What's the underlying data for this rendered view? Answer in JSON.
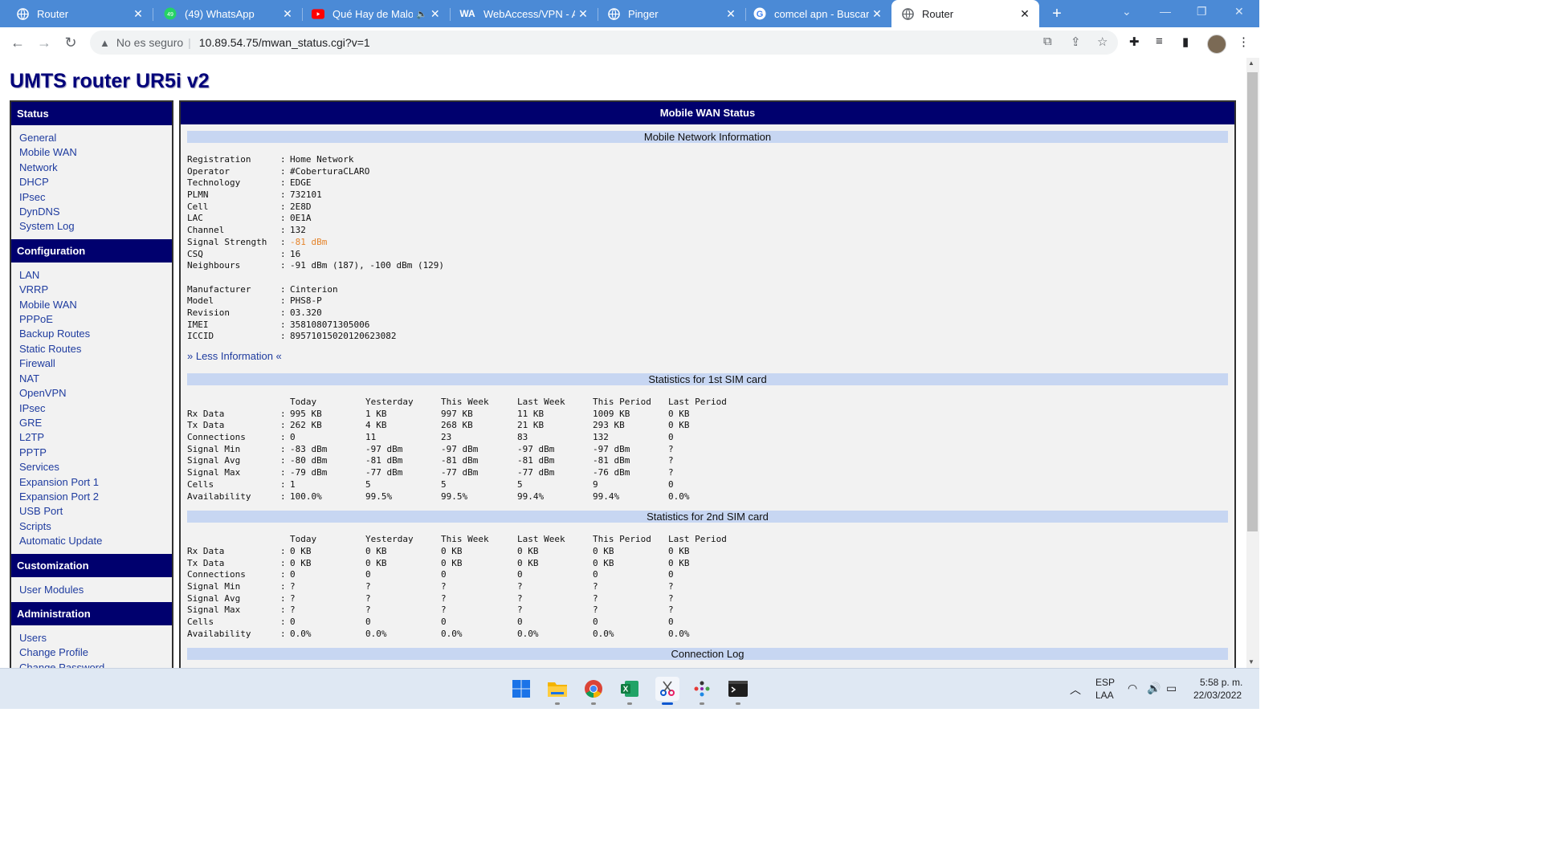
{
  "browser": {
    "tabs": [
      {
        "label": "Router",
        "icon": "globe-icon"
      },
      {
        "label": "(49) WhatsApp",
        "icon": "whatsapp-icon"
      },
      {
        "label": "Qué Hay de Malo",
        "icon": "youtube-icon"
      },
      {
        "label": "WebAccess/VPN - Ad",
        "icon": "webaccess-icon"
      },
      {
        "label": "Pinger",
        "icon": "globe-icon"
      },
      {
        "label": "comcel apn - Buscar",
        "icon": "google-icon"
      },
      {
        "label": "Router",
        "icon": "globe-icon"
      }
    ],
    "active_tab": 6,
    "security_text": "No es seguro",
    "url": "10.89.54.75/mwan_status.cgi?v=1",
    "badge_whatsapp": "49"
  },
  "page": {
    "title": "UMTS router UR5i v2",
    "sidebar": {
      "sections": [
        {
          "heading": "Status",
          "items": [
            "General",
            "Mobile WAN",
            "Network",
            "DHCP",
            "IPsec",
            "DynDNS",
            "System Log"
          ]
        },
        {
          "heading": "Configuration",
          "items": [
            "LAN",
            "VRRP",
            "Mobile WAN",
            "PPPoE",
            "Backup Routes",
            "Static Routes",
            "Firewall",
            "NAT",
            "OpenVPN",
            "IPsec",
            "GRE",
            "L2TP",
            "PPTP",
            "Services",
            "Expansion Port 1",
            "Expansion Port 2",
            "USB Port",
            "Scripts",
            "Automatic Update"
          ]
        },
        {
          "heading": "Customization",
          "items": [
            "User Modules"
          ]
        },
        {
          "heading": "Administration",
          "items": [
            "Users",
            "Change Profile",
            "Change Password"
          ]
        }
      ]
    },
    "main": {
      "heading": "Mobile WAN Status",
      "network_info": {
        "title": "Mobile Network Information",
        "rows": [
          {
            "key": "Registration",
            "value": "Home Network"
          },
          {
            "key": "Operator",
            "value": "#CoberturaCLARO"
          },
          {
            "key": "Technology",
            "value": "EDGE"
          },
          {
            "key": "PLMN",
            "value": "732101"
          },
          {
            "key": "Cell",
            "value": "2E8D"
          },
          {
            "key": "LAC",
            "value": "0E1A"
          },
          {
            "key": "Channel",
            "value": "132"
          },
          {
            "key": "Signal Strength",
            "value": "-81 dBm"
          },
          {
            "key": "CSQ",
            "value": "16"
          },
          {
            "key": "Neighbours",
            "value": "-91 dBm (187), -100 dBm (129)"
          }
        ],
        "device_rows": [
          {
            "key": "Manufacturer",
            "value": "Cinterion"
          },
          {
            "key": "Model",
            "value": "PHS8-P"
          },
          {
            "key": "Revision",
            "value": "03.320"
          },
          {
            "key": "IMEI",
            "value": "358108071305006"
          },
          {
            "key": "ICCID",
            "value": "89571015020120623082"
          }
        ],
        "signal_color": "#e5842b",
        "less_link": "» Less Information «"
      },
      "stats_columns": [
        "Today",
        "Yesterday",
        "This Week",
        "Last Week",
        "This Period",
        "Last Period"
      ],
      "sim1": {
        "title": "Statistics for 1st SIM card",
        "rows": [
          {
            "label": "Rx Data",
            "values": [
              "995 KB",
              "1 KB",
              "997 KB",
              "11 KB",
              "1009 KB",
              "0 KB"
            ]
          },
          {
            "label": "Tx Data",
            "values": [
              "262 KB",
              "4 KB",
              "268 KB",
              "21 KB",
              "293 KB",
              "0 KB"
            ]
          },
          {
            "label": "Connections",
            "values": [
              "0",
              "11",
              "23",
              "83",
              "132",
              "0"
            ]
          },
          {
            "label": "Signal Min",
            "values": [
              "-83 dBm",
              "-97 dBm",
              "-97 dBm",
              "-97 dBm",
              "-97 dBm",
              "?"
            ]
          },
          {
            "label": "Signal Avg",
            "values": [
              "-80 dBm",
              "-81 dBm",
              "-81 dBm",
              "-81 dBm",
              "-81 dBm",
              "?"
            ]
          },
          {
            "label": "Signal Max",
            "values": [
              "-79 dBm",
              "-77 dBm",
              "-77 dBm",
              "-77 dBm",
              "-76 dBm",
              "?"
            ]
          },
          {
            "label": "Cells",
            "values": [
              "1",
              "5",
              "5",
              "5",
              "9",
              "0"
            ]
          },
          {
            "label": "Availability",
            "values": [
              "100.0%",
              "99.5%",
              "99.5%",
              "99.4%",
              "99.4%",
              "0.0%"
            ]
          }
        ]
      },
      "sim2": {
        "title": "Statistics for 2nd SIM card",
        "rows": [
          {
            "label": "Rx Data",
            "values": [
              "0 KB",
              "0 KB",
              "0 KB",
              "0 KB",
              "0 KB",
              "0 KB"
            ]
          },
          {
            "label": "Tx Data",
            "values": [
              "0 KB",
              "0 KB",
              "0 KB",
              "0 KB",
              "0 KB",
              "0 KB"
            ]
          },
          {
            "label": "Connections",
            "values": [
              "0",
              "0",
              "0",
              "0",
              "0",
              "0"
            ]
          },
          {
            "label": "Signal Min",
            "values": [
              "?",
              "?",
              "?",
              "?",
              "?",
              "?"
            ]
          },
          {
            "label": "Signal Avg",
            "values": [
              "?",
              "?",
              "?",
              "?",
              "?",
              "?"
            ]
          },
          {
            "label": "Signal Max",
            "values": [
              "?",
              "?",
              "?",
              "?",
              "?",
              "?"
            ]
          },
          {
            "label": "Cells",
            "values": [
              "0",
              "0",
              "0",
              "0",
              "0",
              "0"
            ]
          },
          {
            "label": "Availability",
            "values": [
              "0.0%",
              "0.0%",
              "0.0%",
              "0.0%",
              "0.0%",
              "0.0%"
            ]
          }
        ]
      },
      "connection_log": {
        "title": "Connection Log"
      }
    }
  },
  "taskbar": {
    "apps": [
      "windows-start-icon",
      "file-explorer-icon",
      "chrome-icon",
      "excel-icon",
      "snipping-tool-icon",
      "network-app-icon",
      "terminal-icon"
    ],
    "language": "ESP",
    "layout": "LAA",
    "time": "5:58 p. m.",
    "date": "22/03/2022"
  },
  "colors": {
    "tabbar": "#4b8ad6",
    "heading_bg": "#00006e",
    "section_bar": "#c7d6f2",
    "link": "#1f3c9f",
    "title": "#00007a"
  }
}
